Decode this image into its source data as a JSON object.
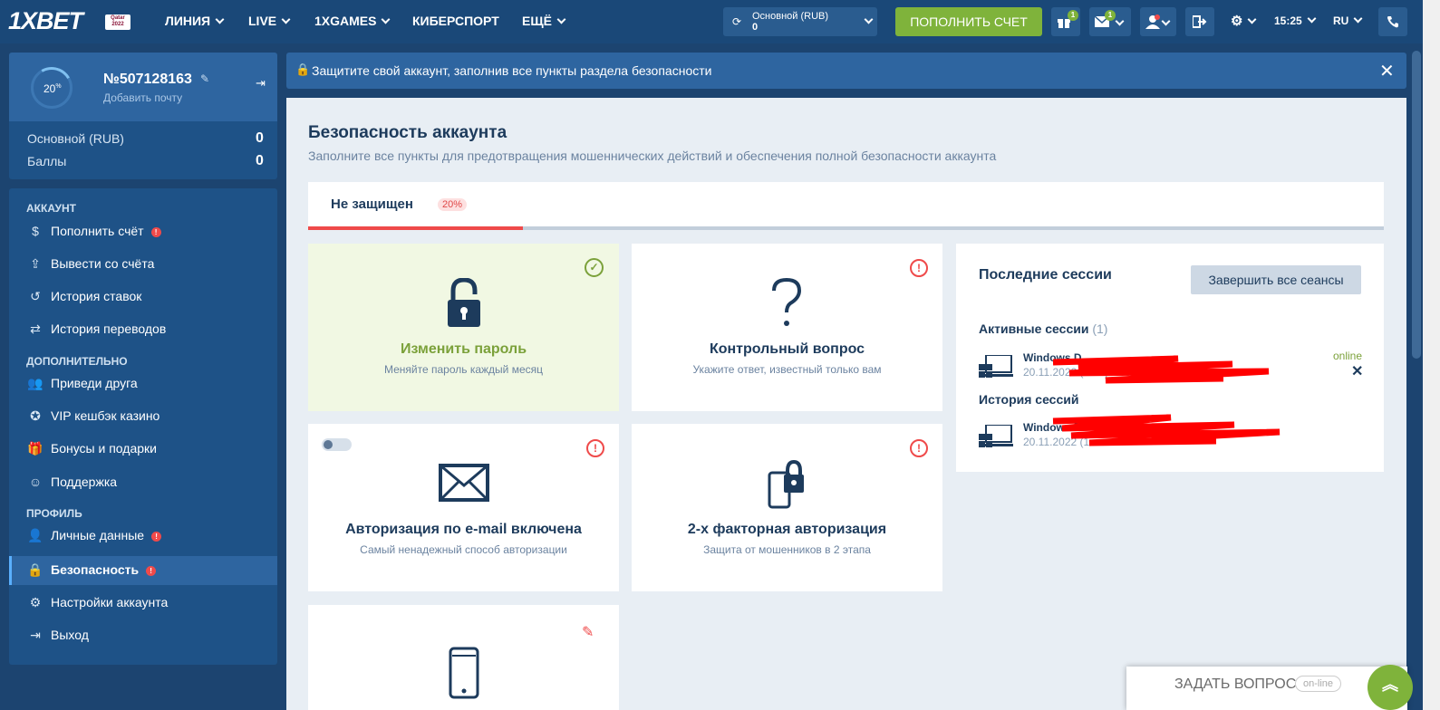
{
  "header": {
    "logo": "1XBET",
    "logo_badge": "Qatar 2022",
    "nav": [
      "ЛИНИЯ",
      "LIVE",
      "1XGAMES",
      "КИБЕРСПОРТ",
      "ЕЩЁ"
    ],
    "account_label": "Основной (RUB)",
    "account_value": "0",
    "deposit_button": "ПОПОЛНИТЬ СЧЕТ",
    "gift_badge": "1",
    "mail_badge": "1",
    "time": "15:25",
    "lang": "RU",
    "icons": [
      "sync-icon",
      "gift-icon",
      "mail-icon",
      "user-icon",
      "logout-icon",
      "gear-icon",
      "phone-icon"
    ],
    "accent": "#7fb33b"
  },
  "profile": {
    "percent": "20",
    "percent_unit": "%",
    "number": "№507128163",
    "add_email": "Добавить почту",
    "balances": [
      {
        "label": "Основной (RUB)",
        "value": "0"
      },
      {
        "label": "Баллы",
        "value": "0"
      }
    ]
  },
  "menu": {
    "sections": [
      "АККАУНТ",
      "ДОПОЛНИТЕЛЬНО",
      "ПРОФИЛЬ"
    ],
    "items": [
      {
        "label": "Пополнить счёт",
        "icon": "dollar-icon"
      },
      {
        "label": "Вывести со счёта",
        "icon": "upload-icon"
      },
      {
        "label": "История ставок",
        "icon": "history-icon"
      },
      {
        "label": "История переводов",
        "icon": "transfer-icon"
      },
      {
        "label": "Приведи друга",
        "icon": "friends-icon"
      },
      {
        "label": "VIP кешбэк казино",
        "icon": "vip-icon"
      },
      {
        "label": "Бонусы и подарки",
        "icon": "gift-icon"
      },
      {
        "label": "Поддержка",
        "icon": "support-icon"
      },
      {
        "label": "Личные данные",
        "icon": "user-icon"
      },
      {
        "label": "Безопасность",
        "icon": "lock-icon"
      },
      {
        "label": "Настройки аккаунта",
        "icon": "gear-icon"
      },
      {
        "label": "Выход",
        "icon": "exit-icon"
      }
    ],
    "alert_mark": "!"
  },
  "notice": {
    "text": "Защитите свой аккаунт, заполнив все пункты раздела безопасности",
    "close": "✕"
  },
  "security": {
    "title": "Безопасность аккаунта",
    "subtitle": "Заполните все пункты для предотвращения мошеннических действий и обеспечения полной безопасности аккаунта",
    "tab_label": "Не защищен",
    "tab_percent": "20%",
    "progress": 0.2,
    "cards": [
      {
        "title": "Изменить пароль",
        "sub": "Меняйте пароль каждый месяц",
        "status": "ok"
      },
      {
        "title": "Контрольный вопрос",
        "sub": "Укажите ответ, известный только вам",
        "status": "warn"
      },
      {
        "title": "Авторизация по e-mail включена",
        "sub": "Самый ненадежный способ авторизации",
        "status": "warn"
      },
      {
        "title": "2-х факторная авторизация",
        "sub": "Защита от мошенников в 2 этапа",
        "status": "warn"
      }
    ],
    "warn_mark": "!",
    "ok_mark": "✓"
  },
  "sessions": {
    "title": "Последние сессии",
    "end_all": "Завершить все сеансы",
    "active_label": "Активные сессии",
    "active_count": "(1)",
    "history_label": "История сессий",
    "active_name": "Windows D",
    "active_date": "20.11.2022 (14:3) Deskto",
    "history_name": "Windows D",
    "history_date": "20.11.2022 (1",
    "online": "online",
    "close": "✕"
  },
  "ask": {
    "label": "ЗАДАТЬ ВОПРОС",
    "status": "on-line"
  }
}
